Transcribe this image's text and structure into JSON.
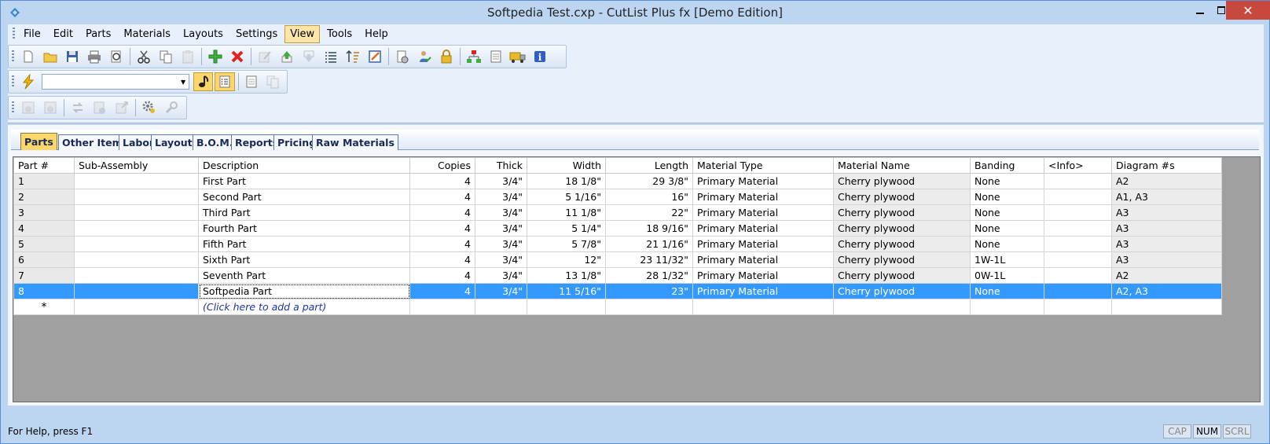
{
  "window": {
    "title": "Softpedia Test.cxp - CutList Plus fx [Demo Edition]",
    "accent": "#bcd6f2"
  },
  "menu": [
    "File",
    "Edit",
    "Parts",
    "Materials",
    "Layouts",
    "Settings",
    "View",
    "Tools",
    "Help"
  ],
  "menu_active": "View",
  "toolbar1_icons": [
    "new-document-icon",
    "open-folder-icon",
    "save-icon",
    "print-icon",
    "print-preview-icon",
    "cut-icon",
    "copy-icon",
    "paste-icon",
    "add-part-icon",
    "delete-part-icon",
    "edit-icon",
    "move-up-icon",
    "move-down-icon",
    "list-icon",
    "sort-icon",
    "properties-icon",
    "settings-document-icon",
    "user-check-icon",
    "lock-icon",
    "hierarchy-icon",
    "document-icon",
    "truck-icon",
    "info-icon"
  ],
  "toolbar2_icons": [
    "lightning-icon",
    "music-note-icon",
    "checklist-icon",
    "page-icon",
    "page-copy-icon"
  ],
  "toolbar3_icons": [
    "layout-a-icon",
    "layout-b-icon",
    "exchange-icon",
    "approve-icon",
    "export-icon",
    "gear-options-icon",
    "wrench-icon"
  ],
  "tabs": [
    "Parts",
    "Other Items",
    "Labor",
    "Layouts",
    "B.O.M.",
    "Reports",
    "Pricing",
    "Raw Materials"
  ],
  "grid": {
    "columns": [
      "Part #",
      "Sub-Assembly",
      "Description",
      "Copies",
      "Thick",
      "Width",
      "Length",
      "Material Type",
      "Material Name",
      "Banding",
      "<Info>",
      "Diagram #s"
    ],
    "rows": [
      [
        "1",
        "",
        "First Part",
        "4",
        "3/4\"",
        "18 1/8\"",
        "29 3/8\"",
        "Primary Material",
        "Cherry plywood",
        "None",
        "",
        "A2"
      ],
      [
        "2",
        "",
        "Second Part",
        "4",
        "3/4\"",
        "5 1/16\"",
        "16\"",
        "Primary Material",
        "Cherry plywood",
        "None",
        "",
        "A1, A3"
      ],
      [
        "3",
        "",
        "Third Part",
        "4",
        "3/4\"",
        "11 1/8\"",
        "22\"",
        "Primary Material",
        "Cherry plywood",
        "None",
        "",
        "A3"
      ],
      [
        "4",
        "",
        "Fourth Part",
        "4",
        "3/4\"",
        "5 1/4\"",
        "18 9/16\"",
        "Primary Material",
        "Cherry plywood",
        "None",
        "",
        "A3"
      ],
      [
        "5",
        "",
        "Fifth Part",
        "4",
        "3/4\"",
        "5 7/8\"",
        "21 1/16\"",
        "Primary Material",
        "Cherry plywood",
        "None",
        "",
        "A3"
      ],
      [
        "6",
        "",
        "Sixth Part",
        "4",
        "3/4\"",
        "12\"",
        "23 11/32\"",
        "Primary Material",
        "Cherry plywood",
        "1W-1L",
        "",
        "A3"
      ],
      [
        "7",
        "",
        "Seventh Part",
        "4",
        "3/4\"",
        "13 1/8\"",
        "28 1/32\"",
        "Primary Material",
        "Cherry plywood",
        "0W-1L",
        "",
        "A2"
      ],
      [
        "8",
        "",
        "Softpedia Part",
        "4",
        "3/4\"",
        "11 5/16\"",
        "23\"",
        "Primary Material",
        "Cherry plywood",
        "None",
        "",
        "A2, A3"
      ]
    ],
    "selected_row": 8,
    "new_row_marker": "*",
    "add_part_text": "(Click here to add a part)"
  },
  "status": {
    "help_text": "For Help, press F1",
    "indicators": [
      "CAP",
      "NUM",
      "SCRL"
    ],
    "active_indicator": "NUM"
  }
}
